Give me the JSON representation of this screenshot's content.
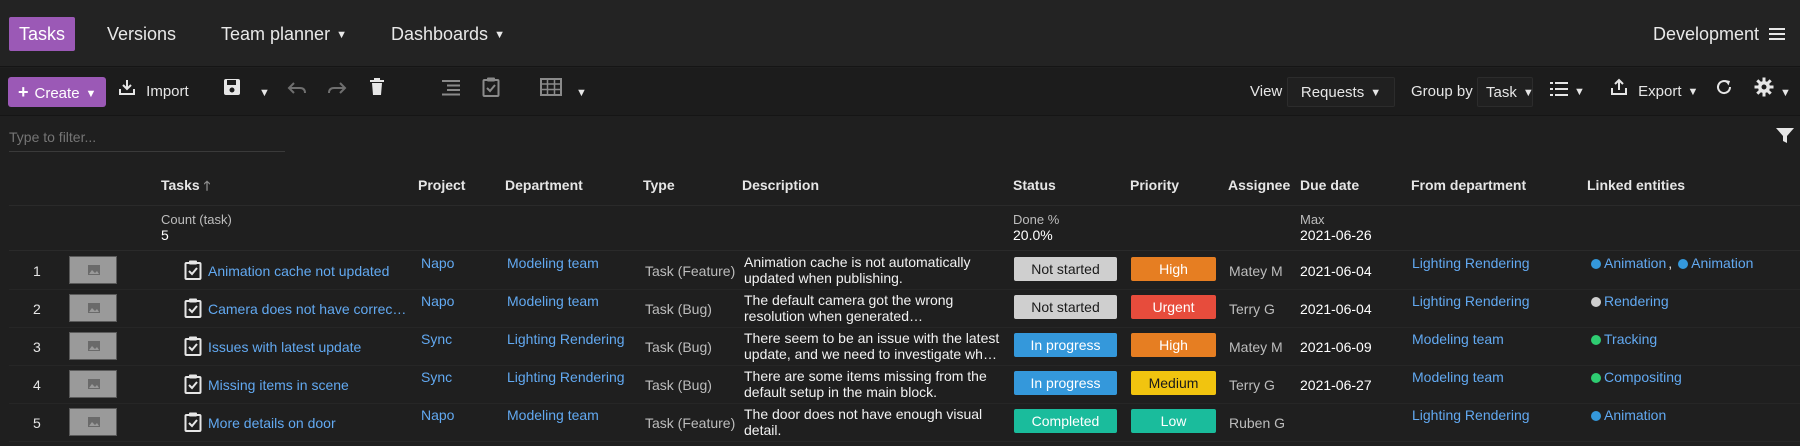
{
  "top_nav": {
    "tabs": [
      {
        "label": "Tasks",
        "active": true
      },
      {
        "label": "Versions"
      },
      {
        "label": "Team planner"
      },
      {
        "label": "Dashboards"
      }
    ],
    "project": "Development"
  },
  "toolbar": {
    "create_label": "Create",
    "import_label": "Import",
    "view_label": "View",
    "view_value": "Requests",
    "group_by_label": "Group by",
    "group_by_value": "Task",
    "export_label": "Export"
  },
  "filter": {
    "placeholder": "Type to filter..."
  },
  "table": {
    "headers": {
      "tasks": "Tasks",
      "project": "Project",
      "department": "Department",
      "type": "Type",
      "description": "Description",
      "status": "Status",
      "priority": "Priority",
      "assignee": "Assignee",
      "due_date": "Due date",
      "from_department": "From department",
      "linked_entities": "Linked entities"
    },
    "summary": {
      "tasks_label": "Count (task)",
      "tasks_value": "5",
      "status_label": "Done %",
      "status_value": "20.0%",
      "due_label": "Max",
      "due_value": "2021-06-26"
    },
    "rows": [
      {
        "num": "1",
        "task": "Animation cache not updated",
        "project": "Napo",
        "department": "Modeling team",
        "type": "Task (Feature)",
        "description": "Animation cache is not automatically updated when publishing.",
        "status": "Not started",
        "status_color": "#cfcfcf",
        "status_text_color": "#1a1a1a",
        "priority": "High",
        "priority_color": "#e67e22",
        "priority_text_color": "#ffffff",
        "assignee": "Matey M",
        "due": "2021-06-04",
        "from_department": "Lighting Rendering",
        "linked_1": "Animation",
        "linked_1_color": "#3498db",
        "linked_sep": ",",
        "linked_2": "Animation",
        "linked_2_color": "#3498db"
      },
      {
        "num": "2",
        "task": "Camera does not have correc…",
        "project": "Napo",
        "department": "Modeling team",
        "type": "Task (Bug)",
        "description": "The default camera got the wrong resolution when generated…",
        "status": "Not started",
        "status_color": "#cfcfcf",
        "status_text_color": "#1a1a1a",
        "priority": "Urgent",
        "priority_color": "#e74c3c",
        "priority_text_color": "#ffffff",
        "assignee": "Terry G",
        "due": "2021-06-04",
        "from_department": "Lighting Rendering",
        "linked_1": "Rendering",
        "linked_1_color": "#cfcfcf"
      },
      {
        "num": "3",
        "task": "Issues with latest update",
        "project": "Sync",
        "department": "Lighting Rendering",
        "type": "Task (Bug)",
        "description": "There seem to be an issue with the latest update, and we need to investigate wh…",
        "status": "In progress",
        "status_color": "#3498db",
        "status_text_color": "#ffffff",
        "priority": "High",
        "priority_color": "#e67e22",
        "priority_text_color": "#ffffff",
        "assignee": "Matey M",
        "due": "2021-06-09",
        "from_department": "Modeling team",
        "linked_1": "Tracking",
        "linked_1_color": "#2ecc71"
      },
      {
        "num": "4",
        "task": "Missing items in scene",
        "project": "Sync",
        "department": "Lighting Rendering",
        "type": "Task (Bug)",
        "description": "There are some items missing from the default setup in the main block.",
        "status": "In progress",
        "status_color": "#3498db",
        "status_text_color": "#ffffff",
        "priority": "Medium",
        "priority_color": "#f1c40f",
        "priority_text_color": "#1a1a1a",
        "assignee": "Terry G",
        "due": "2021-06-27",
        "from_department": "Modeling team",
        "linked_1": "Compositing",
        "linked_1_color": "#2ecc71"
      },
      {
        "num": "5",
        "task": "More details on door",
        "project": "Napo",
        "department": "Modeling team",
        "type": "Task (Feature)",
        "description": "The door does not have enough visual detail.",
        "status": "Completed",
        "status_color": "#1abc9c",
        "status_text_color": "#ffffff",
        "priority": "Low",
        "priority_color": "#1abc9c",
        "priority_text_color": "#ffffff",
        "assignee": "Ruben G",
        "due": "",
        "from_department": "Lighting Rendering",
        "linked_1": "Animation",
        "linked_1_color": "#3498db"
      }
    ]
  }
}
